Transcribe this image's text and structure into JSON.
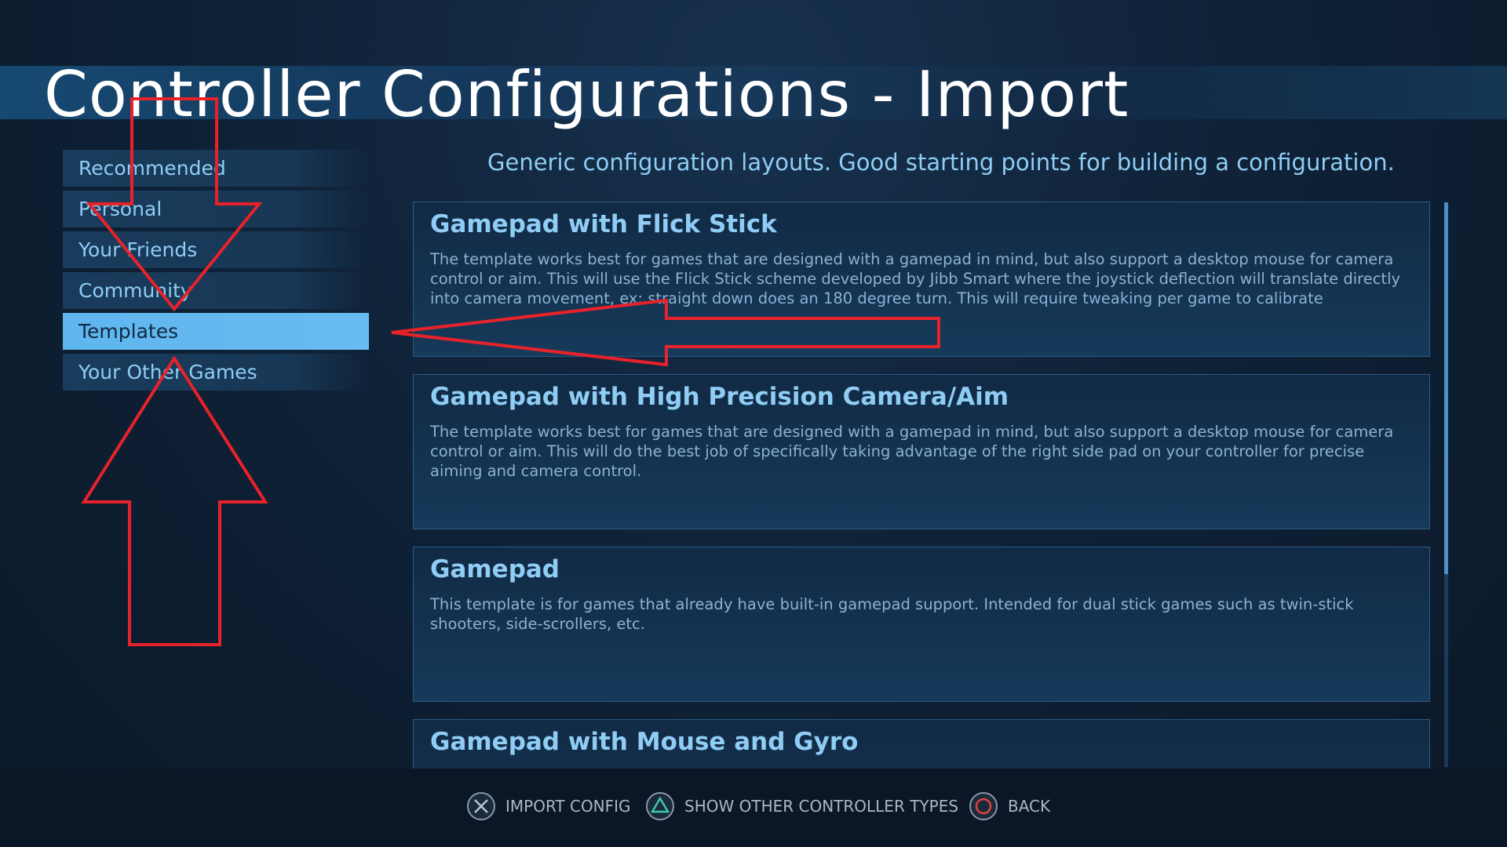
{
  "page": {
    "title": "Controller Configurations - Import",
    "subtitle": "Generic configuration layouts. Good starting points for building a configuration."
  },
  "sidebar": {
    "items": [
      {
        "label": "Recommended",
        "active": false
      },
      {
        "label": "Personal",
        "active": false
      },
      {
        "label": "Your Friends",
        "active": false
      },
      {
        "label": "Community",
        "active": false
      },
      {
        "label": "Templates",
        "active": true
      },
      {
        "label": "Your Other Games",
        "active": false
      }
    ]
  },
  "templates": [
    {
      "title": "Gamepad with Flick Stick",
      "description": "The template works best for games that are designed with a gamepad in mind, but also support a desktop mouse for camera control or aim. This will use the Flick Stick scheme developed by Jibb Smart where the joystick deflection will translate directly into camera movement, ex: straight down does an 180 degree turn. This will require tweaking per game to calibrate"
    },
    {
      "title": "Gamepad with High Precision Camera/Aim",
      "description": "The template works best for games that are designed with a gamepad in mind, but also support a desktop mouse for camera control or aim. This will do the best job of specifically taking advantage of the right side pad on your controller for precise aiming and camera control."
    },
    {
      "title": "Gamepad",
      "description": "This template is for games that already have built-in gamepad support.  Intended for dual stick games such as twin-stick shooters, side-scrollers, etc."
    },
    {
      "title": "Gamepad with Mouse and Gyro",
      "description": ""
    }
  ],
  "footer": {
    "hints": [
      {
        "icon": "cross-button-icon",
        "label": "IMPORT CONFIG"
      },
      {
        "icon": "triangle-button-icon",
        "label": "SHOW OTHER CONTROLLER TYPES"
      },
      {
        "icon": "circle-button-icon",
        "label": "BACK"
      }
    ]
  },
  "colors": {
    "accent": "#67bdf0",
    "text_blue": "#8fcdf5",
    "annotation_red": "#e8222b",
    "triangle_green": "#3fc7a3",
    "circle_red": "#e0413f"
  }
}
